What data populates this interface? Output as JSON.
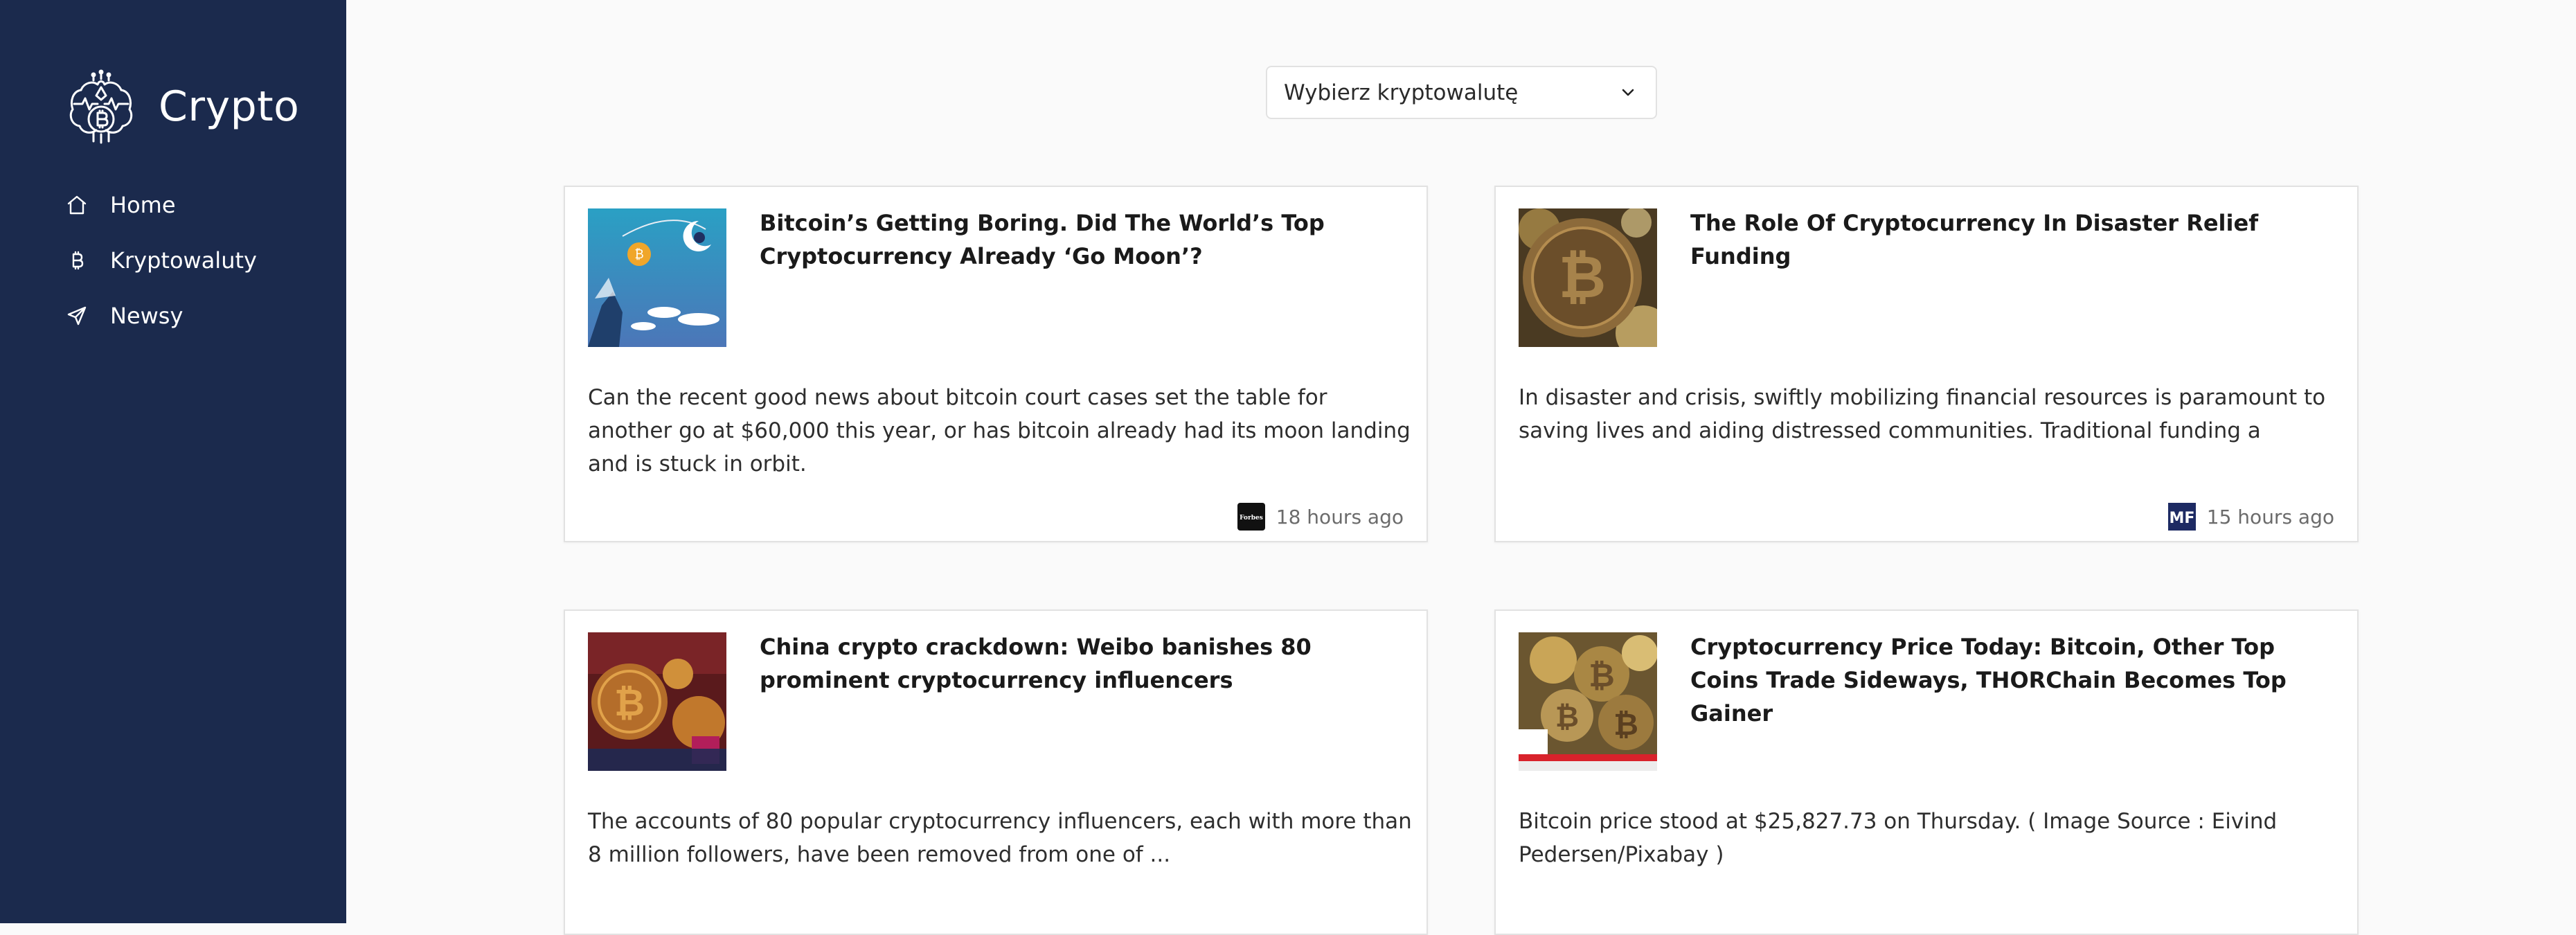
{
  "app": {
    "name": "Crypto",
    "logo_icon": "bitcoin-brain-logo"
  },
  "sidebar": {
    "items": [
      {
        "label": "Home",
        "icon": "home-icon"
      },
      {
        "label": "Kryptowaluty",
        "icon": "bitcoin-icon"
      },
      {
        "label": "Newsy",
        "icon": "send-icon"
      }
    ]
  },
  "currency_select": {
    "value": "Wybierz kryptowalutę",
    "icon": "chevron-down-icon"
  },
  "news": [
    {
      "title": "Bitcoin’s Getting Boring. Did The World’s Top Cryptocurrency Already ‘Go Moon’?",
      "description": "Can the recent good news about bitcoin court cases set the table for another go at $60,000 this year, or has bitcoin already had its moon landing and is stuck in orbit.",
      "time": "18 hours ago",
      "source_logo": "forbes-logo"
    },
    {
      "title": "The Role Of Cryptocurrency In Disaster Relief Funding",
      "description": "In disaster and crisis, swiftly mobilizing financial resources is paramount to saving lives and aiding distressed communities. Traditional funding a",
      "time": "15 hours ago",
      "source_logo": "mf-logo"
    },
    {
      "title": "China crypto crackdown: Weibo banishes 80 prominent cryptocurrency influencers",
      "description": "The accounts of 80 popular cryptocurrency influencers, each with more than 8 million followers, have been removed from one of ...",
      "time": "",
      "source_logo": ""
    },
    {
      "title": "Cryptocurrency Price Today: Bitcoin, Other Top Coins Trade Sideways, THORChain Becomes Top Gainer",
      "description": "Bitcoin price stood at $25,827.73 on Thursday. ( Image Source : Eivind Pedersen/Pixabay )",
      "time": "",
      "source_logo": ""
    }
  ],
  "colors": {
    "sidebar_bg": "#1b2a4d",
    "page_bg": "#fafafa",
    "card_border": "#e2e2e2",
    "muted_text": "#6b6b6b"
  }
}
